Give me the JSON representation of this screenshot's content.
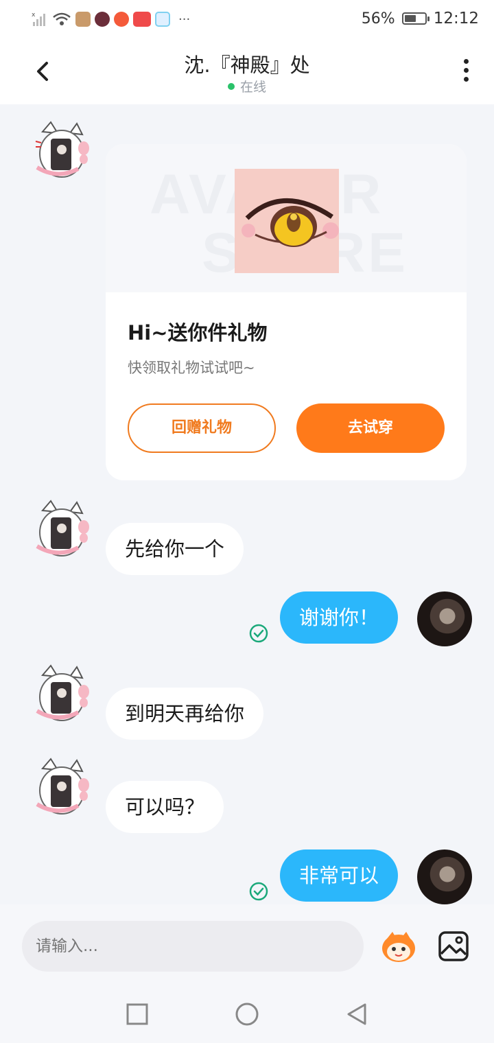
{
  "status_bar": {
    "battery": "56%",
    "time": "12:12",
    "overflow": "···"
  },
  "header": {
    "title": "沈.『神殿』处",
    "status": "在线"
  },
  "gift_card": {
    "watermark_line1": "AVATAR",
    "watermark_line2": "STORE",
    "title": "Hi~送你件礼物",
    "subtitle": "快领取礼物试试吧~",
    "return_gift_label": "回赠礼物",
    "try_on_label": "去试穿"
  },
  "messages": [
    {
      "from": "other",
      "text": "先给你一个"
    },
    {
      "from": "me",
      "text": "谢谢你！",
      "status": "read"
    },
    {
      "from": "other",
      "text": "到明天再给你"
    },
    {
      "from": "other",
      "text": "可以吗？"
    },
    {
      "from": "me",
      "text": "非常可以",
      "status": "read"
    }
  ],
  "composer": {
    "placeholder": "请输入..."
  },
  "colors": {
    "accent_orange": "#ff7a1a",
    "outgoing_bubble": "#2bb7fb",
    "online_dot": "#2bc26a",
    "read_check": "#1aa87a"
  }
}
